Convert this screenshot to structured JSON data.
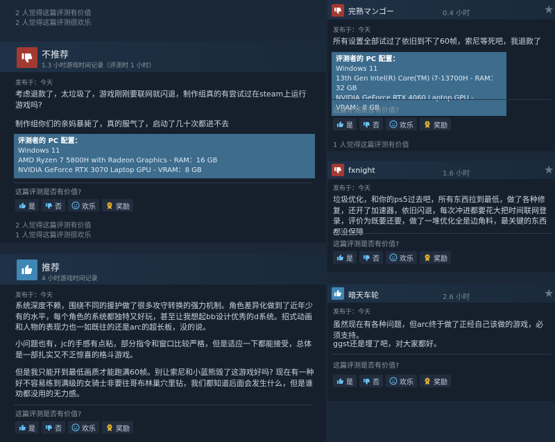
{
  "icons": [
    "thumbs-down-icon",
    "thumbs-up-icon",
    "smile-icon",
    "award-icon",
    "star-icon"
  ],
  "colors": {
    "background": "#1b2838",
    "card": "#16202d",
    "specs": "#3d6c8d",
    "negative": "#a33a32",
    "positive": "#3e87b4"
  },
  "top_helpful": [
    "2 人觉得这篇评测有价值",
    "2 人觉得这篇评测很欢乐"
  ],
  "review1": {
    "verdict": "不推荐",
    "playtime": "1.3 小时游戏时间记录（评测时 1 小时）",
    "posted": "发布于：今天",
    "text1": "考虑退款了，太垃圾了，游戏刚刚要联网就闪退，制作组真的有尝试过在steam上运行游戏吗?",
    "text2": "制作组你们的亲妈暴毙了，真的服气了，启动了几十次都进不去",
    "specs_title": "评测者的 PC 配置：",
    "specs": [
      "Windows 11",
      "AMD Ryzen 7 5800H with Radeon Graphics - RAM：16 GB",
      "NVIDIA GeForce RTX 3070 Laptop GPU - VRAM：8 GB"
    ],
    "question": "这篇评测是否有价值?",
    "helpful_stats": [
      "2 人觉得这篇评测有价值",
      "1 人觉得这篇评测很欢乐"
    ]
  },
  "review2": {
    "verdict": "推荐",
    "playtime": "4 小时游戏时间记录",
    "posted": "发布于：今天",
    "paragraphs": [
      "系统深度不赖，围绕不同的援护做了很多攻守转换的强力机制。角色差异化做到了近年少有的水平，每个角色的系统都独特又好玩，甚至让我想起bb设计优秀的d系统。招式动画和人物的表现力也一如既往的还是arc的超长板，没的说。",
      "小问题也有，jc的手感有点粘，部分指令和窗口比较严格，但是适应一下都能接受，总体是一部扎实又不乏惊喜的格斗游戏。",
      "但是我只能开到最低画质才能跑满60帧。别让索尼和小蓝熊毁了这游戏好吗? 现在有一种好不容易练到满级的女骑士非要往哥布林巢穴里钻，我们都知道后面会发生什么，但是谁劝都没用的无力感。"
    ],
    "question": "这篇评测是否有价值?"
  },
  "review3": {
    "author": "完熟マンゴー",
    "hours": "0.4 小时",
    "posted": "发布于：今天",
    "text": "所有设置全部试过了依旧到不了60帧，索尼等死吧，我退款了",
    "specs_title": "评测者的 PC 配置：",
    "specs": [
      "Windows 11",
      "13th Gen Intel(R) Core(TM) i7-13700H - RAM：32 GB",
      "NVIDIA GeForce RTX 4060 Laptop GPU - VRAM：8 GB"
    ],
    "question": "这篇评测是否有价值?",
    "helpful_stat": "1 人觉得这篇评测有价值"
  },
  "review4": {
    "author": "fxnight",
    "hours": "1.6 小时",
    "posted": "发布于：今天",
    "text": "垃圾优化，和你的ps5过去吧，所有东西拉到最低，做了各种修复，还开了加速器，依旧闪退，每次冲进都要花大把时间联网登录，评价为既要还要，做了一堆优化全是边角料，最关键的东西都没保障",
    "question": "这篇评测是否有价值?"
  },
  "review5": {
    "author": "暗天车轮",
    "hours": "2.6 小时",
    "posted": "发布于：今天",
    "text1": "虽然现在有各种问题，但arc终于做了正经自己该做的游戏，必须支持。",
    "text2": "ggst还是埋了吧，对大家都好。",
    "question": "这篇评测是否有价值?"
  },
  "buttons": {
    "yes": "是",
    "no": "否",
    "funny": "欢乐",
    "award": "奖励"
  }
}
